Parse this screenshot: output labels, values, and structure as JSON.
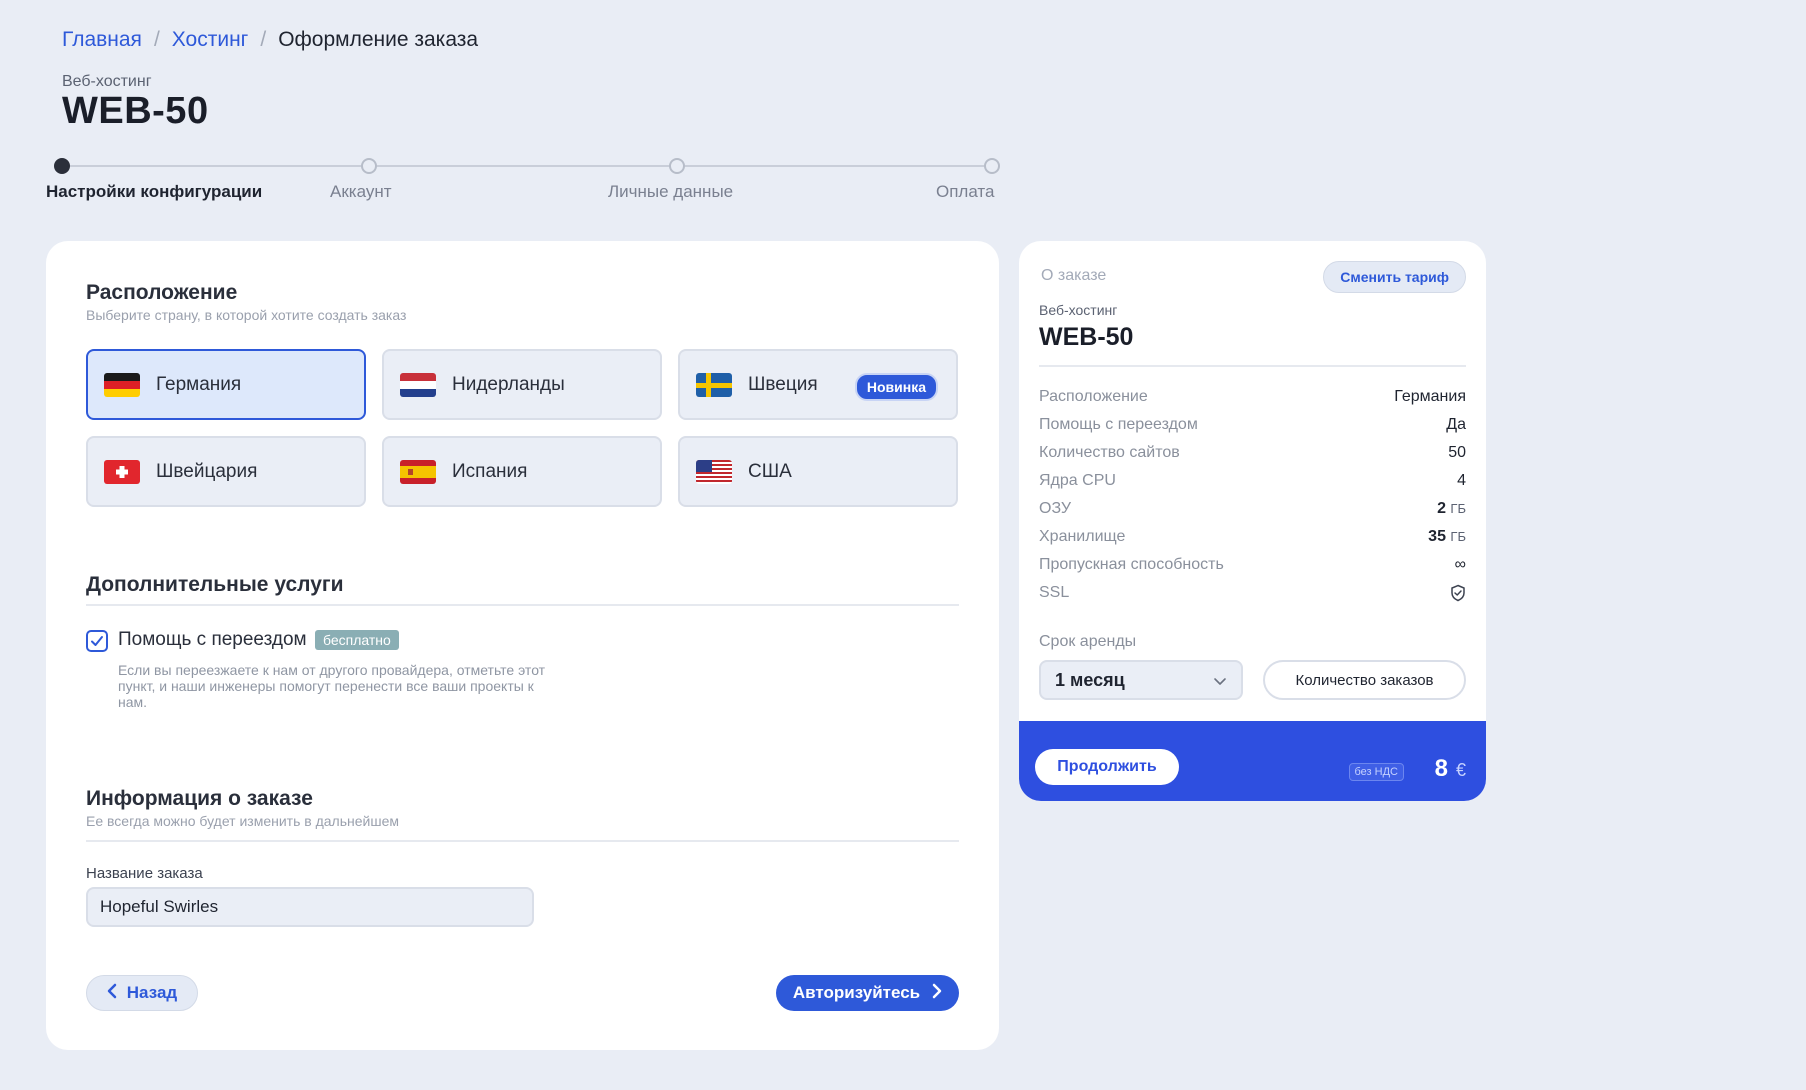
{
  "breadcrumb": {
    "home": "Главная",
    "hosting": "Хостинг",
    "current": "Оформление заказа"
  },
  "page": {
    "subtitle": "Веб-хостинг",
    "title": "WEB-50"
  },
  "steps": [
    "Настройки конфигурации",
    "Аккаунт",
    "Личные данные",
    "Оплата"
  ],
  "location": {
    "title": "Расположение",
    "subtitle": "Выберите страну, в которой хотите создать заказ",
    "options": [
      "Германия",
      "Нидерланды",
      "Швеция",
      "Швейцария",
      "Испания",
      "США"
    ],
    "new_badge": "Новинка"
  },
  "extras": {
    "title": "Дополнительные услуги",
    "migration_label": "Помощь с переездом",
    "free_badge": "бесплатно",
    "migration_desc": "Если вы переезжаете к нам от другого провайдера, отметьте этот пункт, и наши инженеры помогут перенести все ваши проекты к нам."
  },
  "order_info": {
    "title": "Информация о заказе",
    "subtitle": "Ее всегда можно будет изменить в дальнейшем",
    "name_label": "Название заказа",
    "name_value": "Hopeful Swirles"
  },
  "nav": {
    "back": "Назад",
    "auth": "Авторизуйтесь"
  },
  "summary": {
    "heading": "О заказе",
    "change_plan": "Сменить тариф",
    "subtitle": "Веб-хостинг",
    "title": "WEB-50",
    "specs": [
      {
        "k": "Расположение",
        "v": "Германия"
      },
      {
        "k": "Помощь с переездом",
        "v": "Да"
      },
      {
        "k": "Количество сайтов",
        "v": "50"
      },
      {
        "k": "Ядра CPU",
        "v": "4"
      },
      {
        "k": "ОЗУ",
        "v": "2",
        "unit": "ГБ"
      },
      {
        "k": "Хранилище",
        "v": "35",
        "unit": "ГБ"
      },
      {
        "k": "Пропускная способность",
        "v": "∞"
      },
      {
        "k": "SSL",
        "v": ""
      }
    ],
    "term_label": "Срок аренды",
    "term_value": "1 месяц",
    "qty_button": "Количество заказов",
    "continue": "Продолжить",
    "vat": "без НДС",
    "price": "8",
    "currency": "€"
  },
  "colors": {
    "accent": "#2e59d9",
    "footer": "#2e4fe0",
    "bg": "#e9edf5"
  }
}
